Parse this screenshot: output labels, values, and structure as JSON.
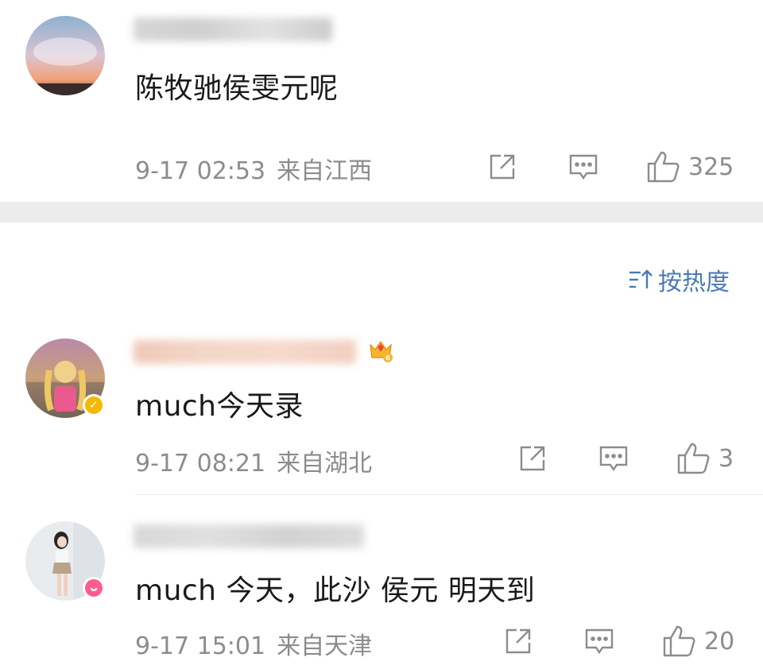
{
  "sort": {
    "label": "按热度"
  },
  "comments": [
    {
      "text": "陈牧驰侯雯元呢",
      "time": "9-17 02:53",
      "location": "来自江西",
      "likes": "325"
    },
    {
      "text": "much今天录",
      "time": "9-17 08:21",
      "location": "来自湖北",
      "likes": "3"
    },
    {
      "text": "much 今天，此沙 侯元 明天到",
      "time": "9-17 15:01",
      "location": "来自天津",
      "likes": "20"
    }
  ],
  "colors": {
    "accent": "#4a79b5",
    "meta": "#8c8c8c",
    "verified_badge": "#f5b800",
    "member_badge": "#ff5c8d"
  }
}
